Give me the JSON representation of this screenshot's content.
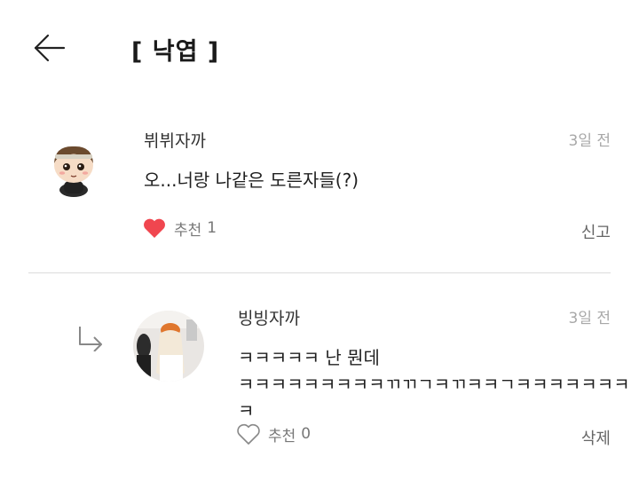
{
  "header": {
    "title": "[ 낙엽 ]",
    "back_icon": "arrow-left-icon"
  },
  "comments": [
    {
      "author": "뷔뷔자까",
      "time": "3일 전",
      "text": "오...너랑 나같은 도른자들(?)",
      "like_label": "추천",
      "like_count": "1",
      "liked": true,
      "action": "신고"
    },
    {
      "author": "빙빙자까",
      "time": "3일 전",
      "lines": [
        "ㅋㅋㅋㅋㅋ 난 뭔데",
        "ㅋㅋㅋㅋㅋㅋㅋㅋㅋㄲㄲㄱㅋㄲㅋㅋㄱㅋㅋㅋㅋㅋㅋㅋㅋ"
      ],
      "like_label": "추천",
      "like_count": "0",
      "liked": false,
      "action": "삭제",
      "is_reply": true
    }
  ],
  "colors": {
    "heart_active": "#f0464f",
    "muted": "#a8a8a8",
    "divider": "#dcdcdc"
  }
}
